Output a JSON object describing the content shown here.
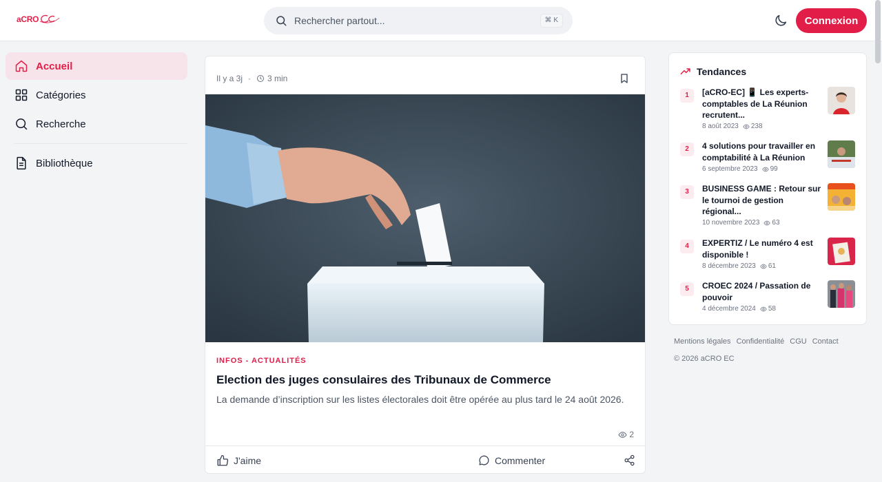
{
  "header": {
    "logo_text": "aCRO",
    "search_placeholder": "Rechercher partout...",
    "search_shortcut": "⌘ K",
    "login_label": "Connexion"
  },
  "sidebar": {
    "items": [
      {
        "label": "Accueil",
        "icon": "home-icon",
        "active": true
      },
      {
        "label": "Catégories",
        "icon": "grid-icon"
      },
      {
        "label": "Recherche",
        "icon": "search-icon"
      },
      {
        "label": "Bibliothèque",
        "icon": "document-icon"
      }
    ]
  },
  "post": {
    "time_ago": "Il y a 3j",
    "read_time": "3 min",
    "category": "INFOS - ACTUALITÉS",
    "title": "Election des juges consulaires des Tribunaux de Commerce",
    "excerpt": "La demande d’inscription sur les listes électorales doit être opérée au plus tard le 24 août 2026.",
    "views": "2",
    "like_label": "J'aime",
    "comment_label": "Commenter"
  },
  "trends": {
    "title": "Tendances",
    "items": [
      {
        "rank": "1",
        "title": "[aCRO-EC] 📱 Les experts-comptables de La Réunion recrutent...",
        "date": "8 août 2023",
        "views": "238"
      },
      {
        "rank": "2",
        "title": "4 solutions pour travailler en comptabilité à La Réunion",
        "date": "6 septembre 2023",
        "views": "99"
      },
      {
        "rank": "3",
        "title": "BUSINESS GAME : Retour sur le tournoi de gestion régional...",
        "date": "10 novembre 2023",
        "views": "63"
      },
      {
        "rank": "4",
        "title": "EXPERTIZ / Le numéro 4 est disponible !",
        "date": "8 décembre 2023",
        "views": "61"
      },
      {
        "rank": "5",
        "title": "CROEC 2024 / Passation de pouvoir",
        "date": "4 décembre 2024",
        "views": "58"
      }
    ]
  },
  "footer": {
    "links": [
      "Mentions légales",
      "Confidentialité",
      "CGU",
      "Contact"
    ],
    "copyright": "© 2026 aCRO EC"
  },
  "colors": {
    "accent": "#e11d48",
    "active_bg": "#f6e4ea"
  }
}
